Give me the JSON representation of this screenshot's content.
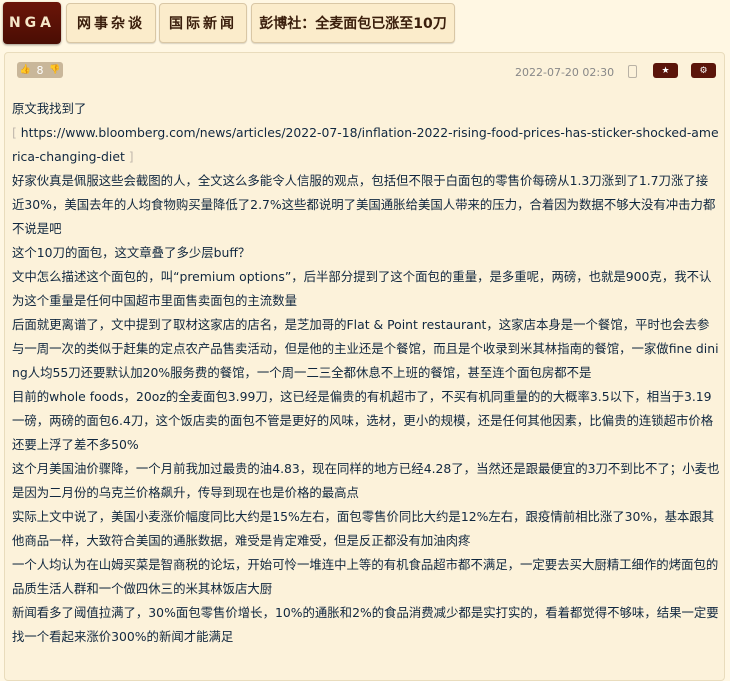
{
  "nav": {
    "logo": "NGA",
    "crumbs": [
      "网事杂谈",
      "国际新闻",
      "彭博社：全麦面包已涨至10刀"
    ]
  },
  "post": {
    "votes": "8",
    "date": "2022-07-20 02:30",
    "icons": {
      "vote_up": "thumbs-up-icon",
      "vote_down": "thumbs-down-icon",
      "star": "star-icon",
      "gear": "gear-icon",
      "device": "phone-icon"
    },
    "intro": "原文我找到了",
    "url_open": "[",
    "url": "https://www.bloomberg.com/news/articles/2022-07-18/inflation-2022-rising-food-prices-has-sticker-shocked-america-changing-diet",
    "url_close": "]",
    "paragraphs": [
      "好家伙真是佩服这些会截图的人，全文这么多能令人信服的观点，包括但不限于白面包的零售价每磅从1.3刀涨到了1.7刀涨了接近30%，美国去年的人均食物购买量降低了2.7%这些都说明了美国通胀给美国人带来的压力，合着因为数据不够大没有冲击力都不说是吧",
      "这个10刀的面包，这文章叠了多少层buff？",
      "文中怎么描述这个面包的，叫“premium options”，后半部分提到了这个面包的重量，是多重呢，两磅，也就是900克，我不认为这个重量是任何中国超市里面售卖面包的主流数量",
      "后面就更离谱了，文中提到了取材这家店的店名，是芝加哥的Flat & Point restaurant，这家店本身是一个餐馆，平时也会去参与一周一次的类似于赶集的定点农产品售卖活动，但是他的主业还是个餐馆，而且是个收录到米其林指南的餐馆，一家做fine dining人均55刀还要默认加20%服务费的餐馆，一个周一二三全都休息不上班的餐馆，甚至连个面包房都不是",
      "目前的whole foods，20oz的全麦面包3.99刀，这已经是偏贵的有机超市了，不买有机同重量的的大概率3.5以下，相当于3.19一磅，两磅的面包6.4刀，这个饭店卖的面包不管是更好的风味，选材，更小的规模，还是任何其他因素，比偏贵的连锁超市价格还要上浮了差不多50%",
      "这个月美国油价骤降，一个月前我加过最贵的油4.83，现在同样的地方已经4.28了，当然还是跟最便宜的3刀不到比不了；小麦也是因为二月份的乌克兰价格飙升，传导到现在也是价格的最高点",
      "实际上文中说了，美国小麦涨价幅度同比大约是15%左右，面包零售价同比大约是12%左右，跟疫情前相比涨了30%，基本跟其他商品一样，大致符合美国的通胀数据，难受是肯定难受，但是反正都没有加油肉疼",
      "一个人均认为在山姆买菜是智商税的论坛，开始可怜一堆连中上等的有机食品超市都不满足，一定要去买大厨精工细作的烤面包的品质生活人群和一个做四休三的米其林饭店大厨",
      "新闻看多了阈值拉满了，30%面包零售价增长，10%的通胀和2%的食品消费减少都是实打实的，看着都觉得不够味，结果一定要找一个看起来涨价300%的新闻才能满足"
    ]
  }
}
